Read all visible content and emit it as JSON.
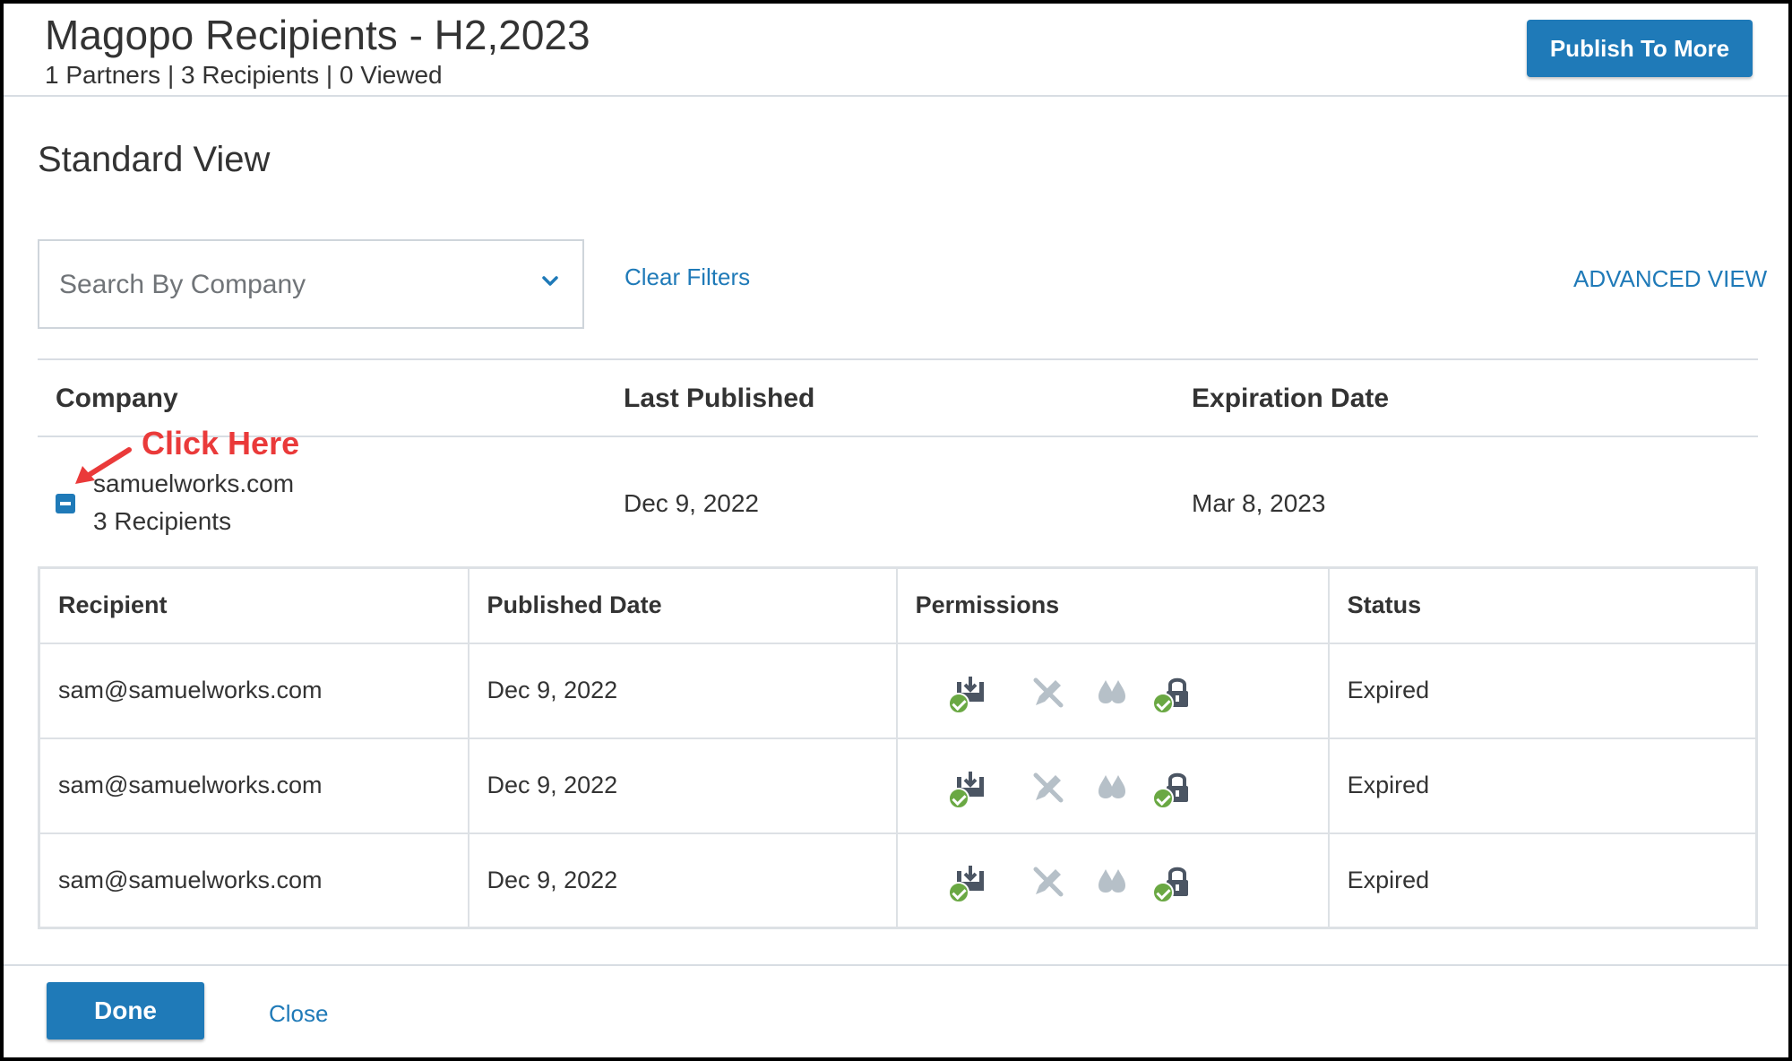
{
  "header": {
    "title": "Magopo Recipients - H2,2023",
    "subtitle": "1 Partners | 3 Recipients | 0 Viewed",
    "publish_button": "Publish To More"
  },
  "view_title": "Standard View",
  "filters": {
    "search_placeholder": "Search By Company",
    "clear_filters": "Clear Filters",
    "advanced_view": "ADVANCED VIEW"
  },
  "companies_table": {
    "headers": {
      "company": "Company",
      "last_published": "Last Published",
      "expiration_date": "Expiration Date"
    },
    "row": {
      "company": "samuelworks.com",
      "recipients": "3 Recipients",
      "last_published": "Dec 9, 2022",
      "expiration_date": "Mar 8, 2023"
    }
  },
  "annotation": {
    "text": "Click Here",
    "color": "#ea3a3a"
  },
  "recipients_table": {
    "headers": {
      "recipient": "Recipient",
      "published_date": "Published Date",
      "permissions": "Permissions",
      "status": "Status"
    },
    "rows": [
      {
        "recipient": "sam@samuelworks.com",
        "published_date": "Dec 9, 2022",
        "status": "Expired"
      },
      {
        "recipient": "sam@samuelworks.com",
        "published_date": "Dec 9, 2022",
        "status": "Expired"
      },
      {
        "recipient": "sam@samuelworks.com",
        "published_date": "Dec 9, 2022",
        "status": "Expired"
      }
    ],
    "permission_icons": [
      "download-icon",
      "edit-disabled-icon",
      "watermark-icon",
      "lock-icon"
    ]
  },
  "footer": {
    "done_button": "Done",
    "close_link": "Close"
  },
  "colors": {
    "accent": "#1f7ab8",
    "check_green": "#6aa843"
  }
}
